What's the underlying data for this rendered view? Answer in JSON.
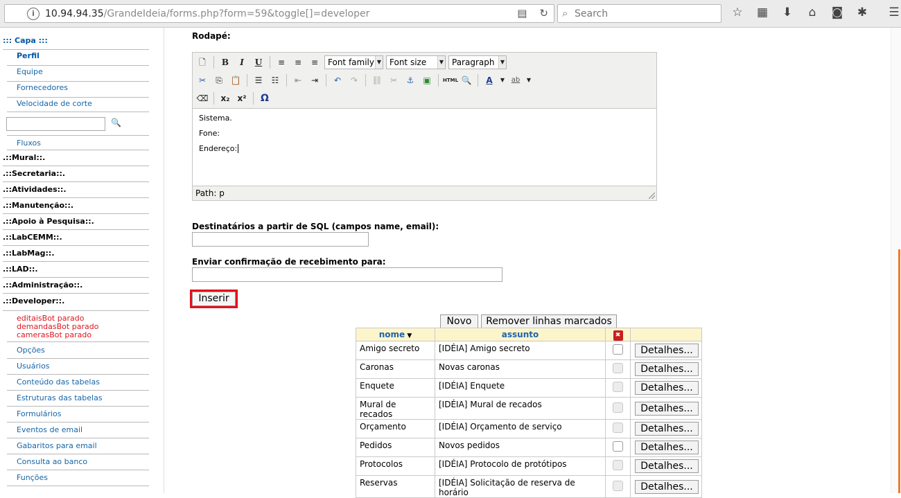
{
  "browser": {
    "url_host": "10.94.94.35",
    "url_path": "/GrandeIdeia/forms.php?form=59&toggle[]=developer",
    "search_placeholder": "Search"
  },
  "sidebar": {
    "capa": "::: Capa :::",
    "capa_items": [
      "Perfil",
      "Equipe",
      "Fornecedores",
      "Velocidade de corte"
    ],
    "search_button": "🔍",
    "fluxos": "Fluxos",
    "sections": [
      ".::Mural::.",
      ".::Secretaria::.",
      ".::Atividades::.",
      ".::Manutenção::.",
      ".::Apoio à Pesquisa::.",
      ".::LabCEMM::.",
      ".::LabMag::.",
      ".::LAD::.",
      ".::Administração::.",
      ".::Developer::."
    ],
    "bot_status": [
      "editaisBot parado",
      "demandasBot parado",
      "camerasBot parado"
    ],
    "developer_items": [
      "Opções",
      "Usuários",
      "Conteúdo das tabelas",
      "Estruturas das tabelas",
      "Formulários",
      "Eventos de email",
      "Gabaritos para email",
      "Consulta ao banco",
      "Funções"
    ]
  },
  "form": {
    "rodape_label": "Rodapé:",
    "editor": {
      "font_family": "Font family",
      "font_size": "Font size",
      "format": "Paragraph",
      "body_lines": [
        "Sistema.",
        "Fone:",
        "Endereço:"
      ],
      "path": "Path: p"
    },
    "sql_label": "Destinatários a partir de SQL (campos name, email):",
    "sql_value": "",
    "confirm_label": "Enviar confirmação de recebimento para:",
    "confirm_value": "",
    "insert_button": "Inserir"
  },
  "table_actions": {
    "new_button": "Novo",
    "remove_button": "Remover linhas marcados"
  },
  "table": {
    "headers": [
      "nome",
      "assunto"
    ],
    "detail_button": "Detalhes...",
    "rows": [
      {
        "nome": "Amigo secreto",
        "assunto": "[IDÉIA] Amigo secreto",
        "enabled": true
      },
      {
        "nome": "Caronas",
        "assunto": "Novas caronas",
        "enabled": false
      },
      {
        "nome": "Enquete",
        "assunto": "[IDÉIA] Enquete",
        "enabled": false
      },
      {
        "nome": "Mural de recados",
        "assunto": "[IDÉIA] Mural de recados",
        "enabled": false
      },
      {
        "nome": "Orçamento",
        "assunto": "[IDÉIA] Orçamento de serviço",
        "enabled": false
      },
      {
        "nome": "Pedidos",
        "assunto": "Novos pedidos",
        "enabled": true
      },
      {
        "nome": "Protocolos",
        "assunto": "[IDÉIA] Protocolo de protótipos",
        "enabled": false
      },
      {
        "nome": "Reservas",
        "assunto": "[IDÉIA] Solicitação de reserva de horário",
        "enabled": false
      }
    ]
  }
}
